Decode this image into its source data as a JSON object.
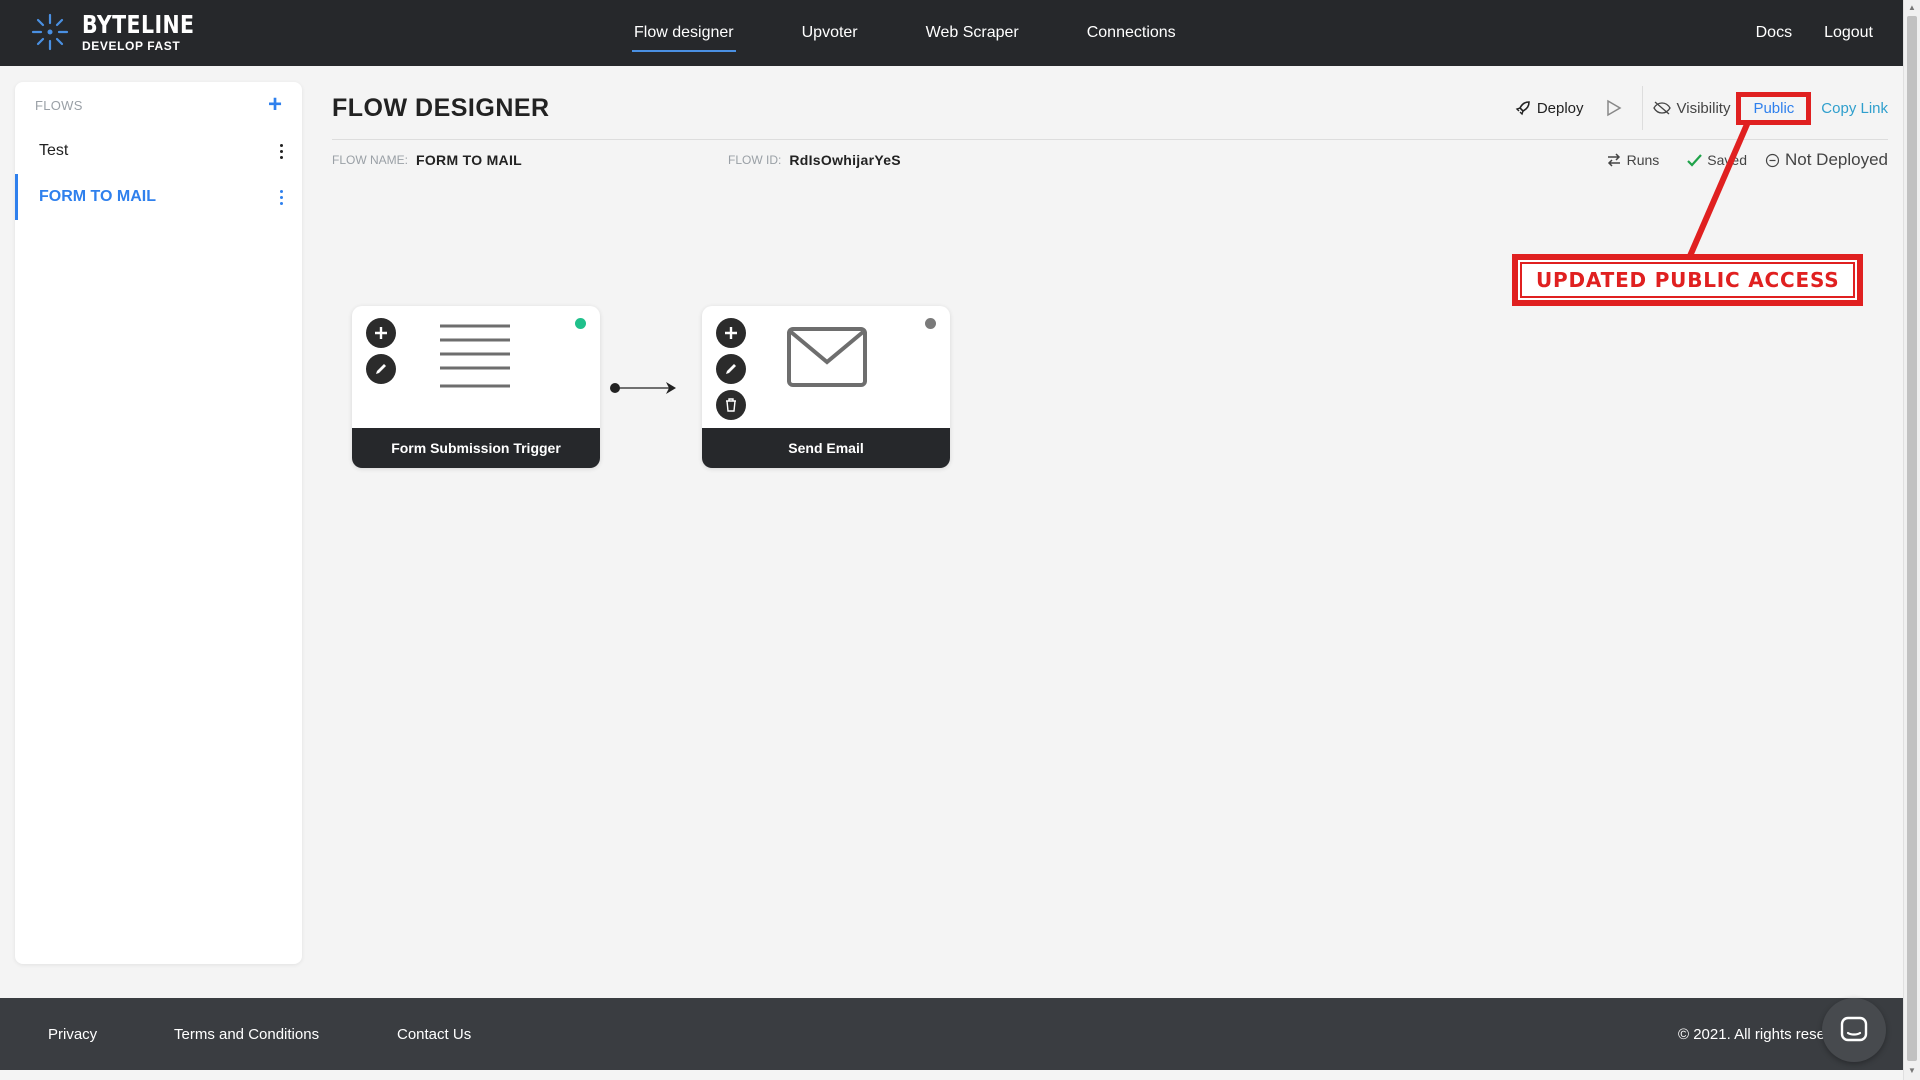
{
  "brand": {
    "name": "BYTELINE",
    "tagline": "DEVELOP FAST"
  },
  "nav": {
    "items": [
      {
        "label": "Flow designer",
        "active": true
      },
      {
        "label": "Upvoter",
        "active": false
      },
      {
        "label": "Web Scraper",
        "active": false
      },
      {
        "label": "Connections",
        "active": false
      }
    ],
    "docs": "Docs",
    "logout": "Logout"
  },
  "sidebar": {
    "title": "FLOWS",
    "items": [
      {
        "label": "Test",
        "active": false
      },
      {
        "label": "FORM TO MAIL",
        "active": true
      }
    ]
  },
  "main": {
    "title": "FLOW DESIGNER",
    "toolbar": {
      "deploy": "Deploy",
      "visibility": "Visibility",
      "public": "Public",
      "copy_link": "Copy Link"
    },
    "flow_name_label": "FLOW NAME:",
    "flow_name": "FORM TO MAIL",
    "flow_id_label": "FLOW ID:",
    "flow_id": "RdIsOwhijarYeS",
    "status": {
      "runs": "Runs",
      "saved": "Saved",
      "deployment": "Not Deployed"
    }
  },
  "nodes": [
    {
      "label": "Form Submission Trigger",
      "status_color": "#1fc08b"
    },
    {
      "label": "Send Email",
      "status_color": "#7a7a7a"
    }
  ],
  "annotation": {
    "text": "UPDATED PUBLIC ACCESS",
    "color": "#e02020"
  },
  "footer": {
    "privacy": "Privacy",
    "terms": "Terms and Conditions",
    "contact": "Contact Us",
    "copyright": "© 2021. All rights reserved."
  },
  "colors": {
    "accent": "#2f80ed",
    "dark": "#26282b",
    "saved": "#1fa34a"
  }
}
